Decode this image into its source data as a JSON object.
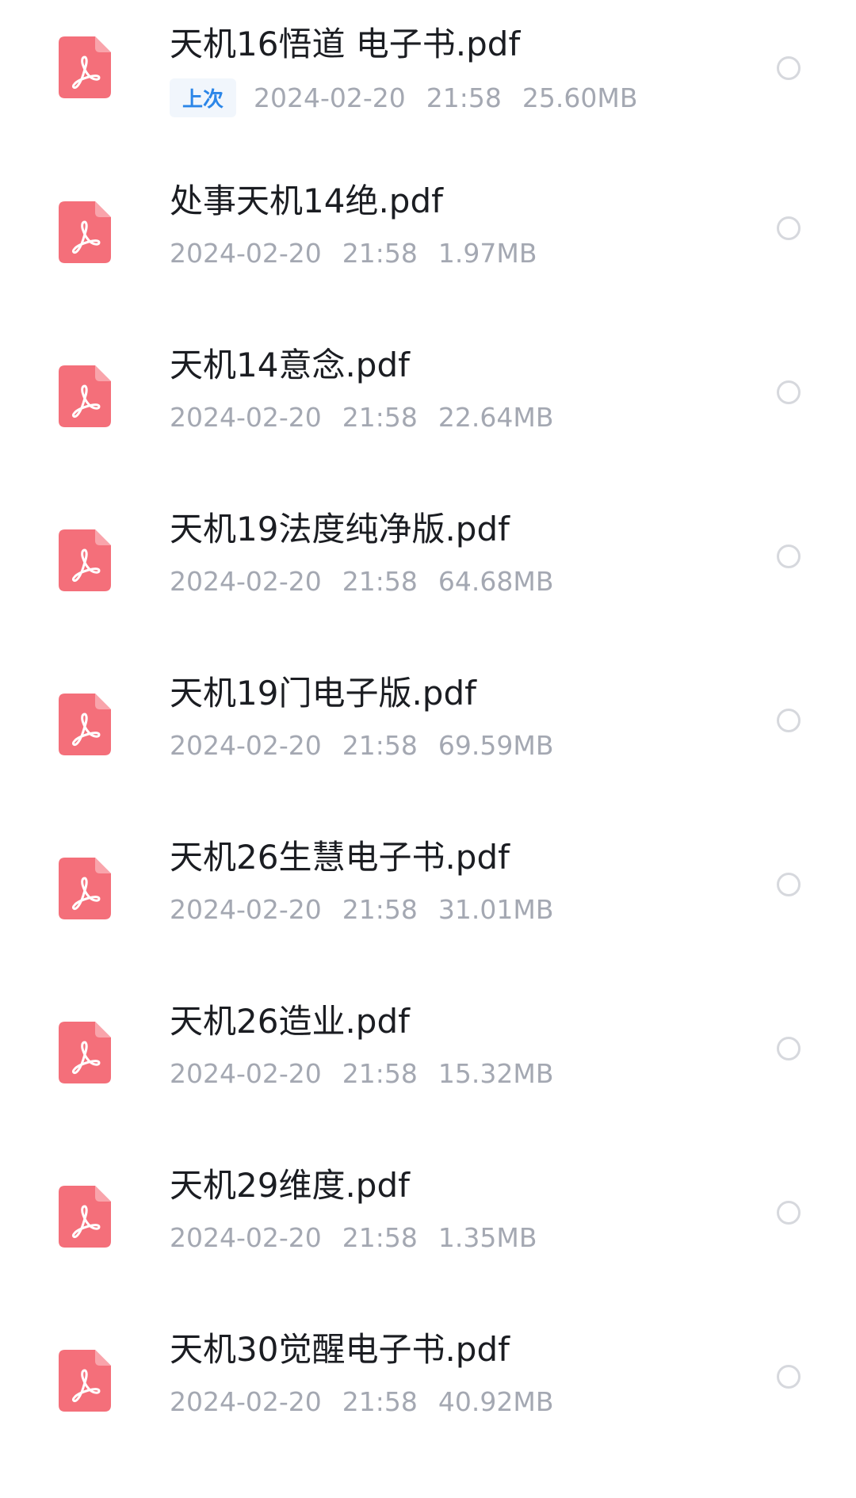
{
  "files": [
    {
      "name": "天机16悟道 电子书.pdf",
      "badge": "上次",
      "date": "2024-02-20",
      "time": "21:58",
      "size": "25.60MB"
    },
    {
      "name": "处事天机14绝.pdf",
      "badge": "",
      "date": "2024-02-20",
      "time": "21:58",
      "size": "1.97MB"
    },
    {
      "name": "天机14意念.pdf",
      "badge": "",
      "date": "2024-02-20",
      "time": "21:58",
      "size": "22.64MB"
    },
    {
      "name": "天机19法度纯净版.pdf",
      "badge": "",
      "date": "2024-02-20",
      "time": "21:58",
      "size": "64.68MB"
    },
    {
      "name": "天机19门电子版.pdf",
      "badge": "",
      "date": "2024-02-20",
      "time": "21:58",
      "size": "69.59MB"
    },
    {
      "name": "天机26生慧电子书.pdf",
      "badge": "",
      "date": "2024-02-20",
      "time": "21:58",
      "size": "31.01MB"
    },
    {
      "name": "天机26造业.pdf",
      "badge": "",
      "date": "2024-02-20",
      "time": "21:58",
      "size": "15.32MB"
    },
    {
      "name": "天机29维度.pdf",
      "badge": "",
      "date": "2024-02-20",
      "time": "21:58",
      "size": "1.35MB"
    },
    {
      "name": "天机30觉醒电子书.pdf",
      "badge": "",
      "date": "2024-02-20",
      "time": "21:58",
      "size": "40.92MB"
    }
  ],
  "icons": {
    "file_type": "pdf-icon",
    "select": "radio-icon"
  },
  "colors": {
    "pdf_icon": "#f46f7a",
    "badge_text": "#2b86e8",
    "meta_text": "#a4a8b2",
    "name_text": "#1b1d22"
  }
}
